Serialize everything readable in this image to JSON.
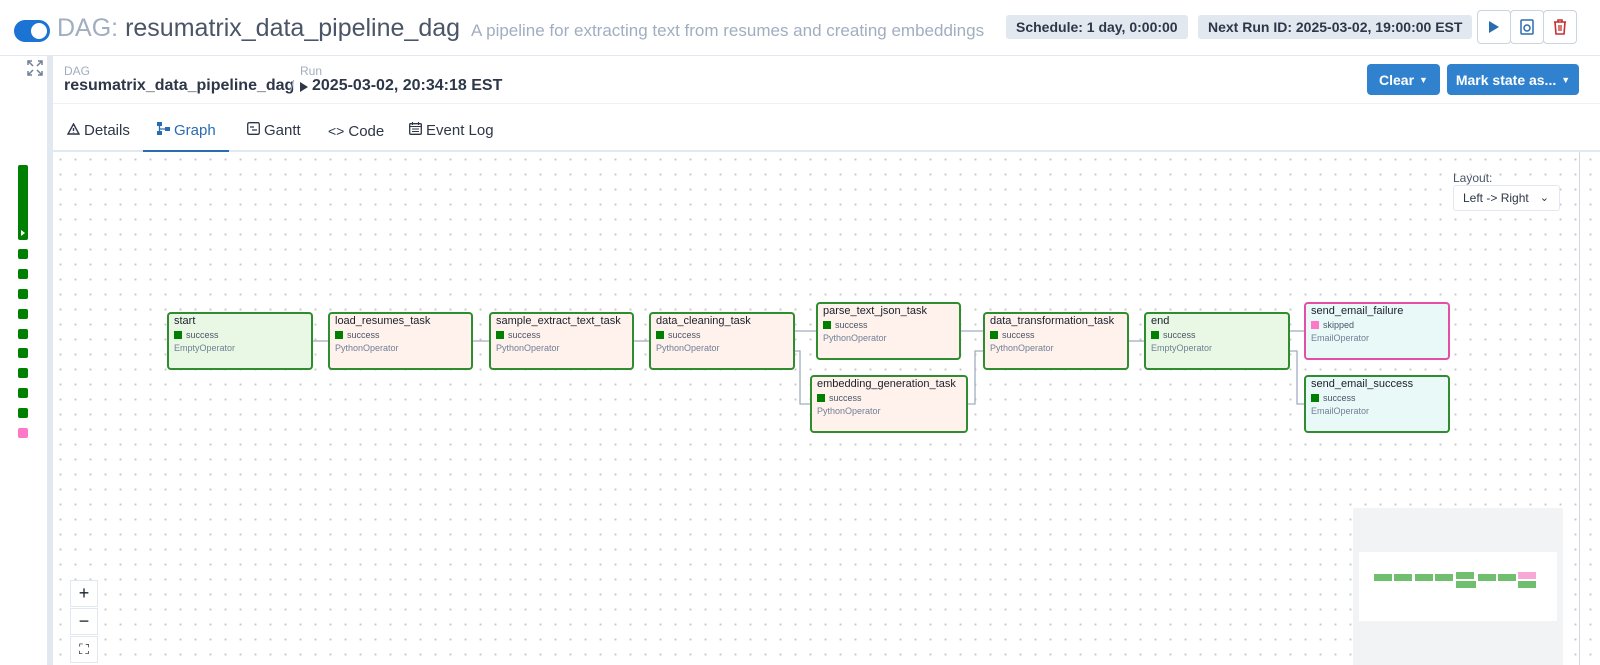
{
  "header": {
    "dag_label": "DAG:",
    "dag_name": "resumatrix_data_pipeline_dag",
    "description": "A pipeline for extracting text from resumes and creating embeddings",
    "schedule": "Schedule: 1 day, 0:00:00",
    "next_run": "Next Run ID: 2025-03-02, 19:00:00 EST",
    "toggle_on": true
  },
  "breadcrumb": {
    "dag_small": "DAG",
    "dag_value": "resumatrix_data_pipeline_dag",
    "separator": "/",
    "run_small": "Run",
    "run_value": "2025-03-02, 20:34:18 EST"
  },
  "actions": {
    "clear": "Clear",
    "mark_state": "Mark state as..."
  },
  "tabs": [
    {
      "label": "Details",
      "icon": "warning-icon"
    },
    {
      "label": "Graph",
      "icon": "graph-icon",
      "active": true
    },
    {
      "label": "Gantt",
      "icon": "gantt-icon"
    },
    {
      "label": "Code",
      "icon": "code-icon"
    },
    {
      "label": "Event Log",
      "icon": "calendar-icon"
    }
  ],
  "layout": {
    "label": "Layout:",
    "value": "Left -> Right"
  },
  "tasks": [
    {
      "name": "start",
      "state": "success",
      "operator": "EmptyOperator"
    },
    {
      "name": "load_resumes_task",
      "state": "success",
      "operator": "PythonOperator"
    },
    {
      "name": "sample_extract_text_task",
      "state": "success",
      "operator": "PythonOperator"
    },
    {
      "name": "data_cleaning_task",
      "state": "success",
      "operator": "PythonOperator"
    },
    {
      "name": "parse_text_json_task",
      "state": "success",
      "operator": "PythonOperator"
    },
    {
      "name": "embedding_generation_task",
      "state": "success",
      "operator": "PythonOperator"
    },
    {
      "name": "data_transformation_task",
      "state": "success",
      "operator": "PythonOperator"
    },
    {
      "name": "end",
      "state": "success",
      "operator": "EmptyOperator"
    },
    {
      "name": "send_email_failure",
      "state": "skipped",
      "operator": "EmailOperator"
    },
    {
      "name": "send_email_success",
      "state": "success",
      "operator": "EmailOperator"
    }
  ],
  "zoom": {
    "in": "+",
    "out": "−",
    "fit": "⛶"
  },
  "colors": {
    "success": "#008000",
    "skipped": "#ff78c8",
    "primary": "#3182ce"
  }
}
